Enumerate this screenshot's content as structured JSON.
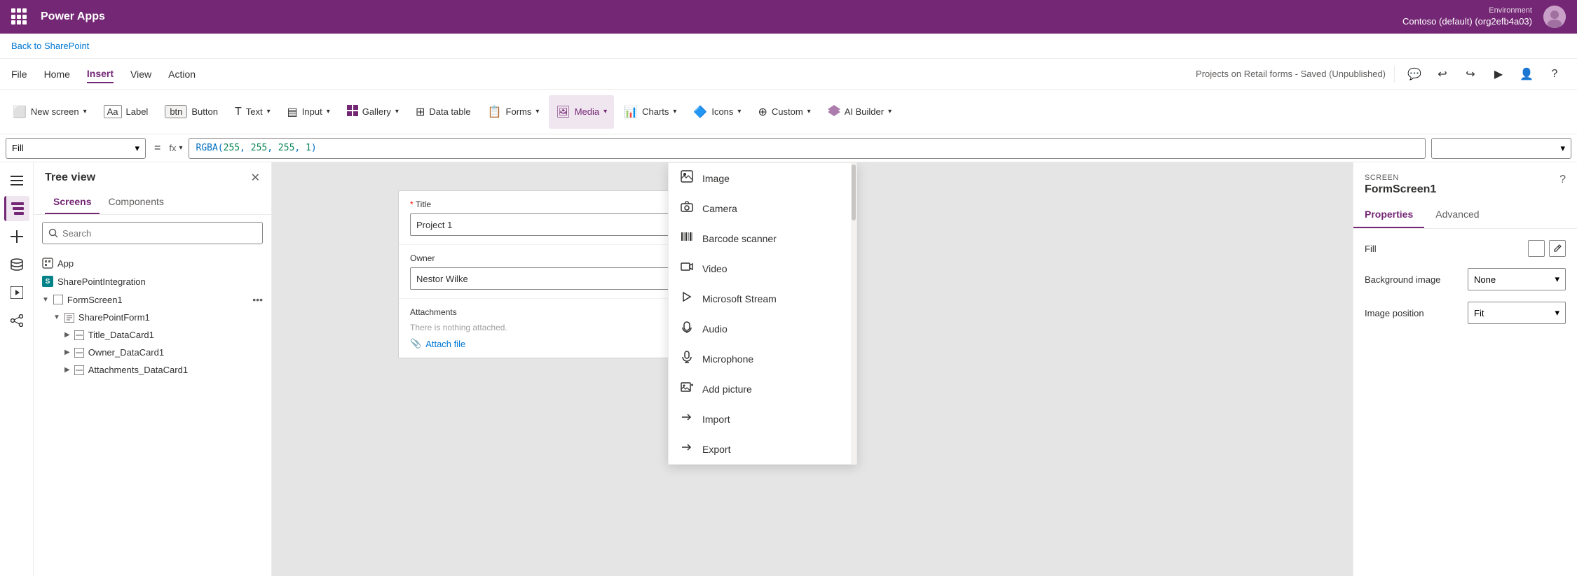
{
  "app": {
    "title": "Power Apps",
    "env_label": "Environment",
    "env_name": "Contoso (default) (org2efb4a03)"
  },
  "breadcrumb": {
    "link": "Back to SharePoint"
  },
  "menubar": {
    "items": [
      "File",
      "Home",
      "Insert",
      "View",
      "Action"
    ],
    "active": "Insert",
    "save_status": "Projects on Retail forms - Saved (Unpublished)"
  },
  "ribbon": {
    "items": [
      {
        "id": "new-screen",
        "label": "New screen",
        "icon": "⬜",
        "has_caret": true
      },
      {
        "id": "label",
        "label": "Label",
        "icon": "🏷",
        "has_caret": false
      },
      {
        "id": "button",
        "label": "Button",
        "icon": "⬛",
        "has_caret": false
      },
      {
        "id": "text",
        "label": "Text",
        "icon": "T",
        "has_caret": true
      },
      {
        "id": "input",
        "label": "Input",
        "icon": "▤",
        "has_caret": true
      },
      {
        "id": "gallery",
        "label": "Gallery",
        "icon": "▦",
        "has_caret": true
      },
      {
        "id": "data-table",
        "label": "Data table",
        "icon": "⊞",
        "has_caret": false
      },
      {
        "id": "forms",
        "label": "Forms",
        "icon": "📋",
        "has_caret": true
      },
      {
        "id": "media",
        "label": "Media",
        "icon": "🖼",
        "has_caret": true,
        "active": true
      },
      {
        "id": "charts",
        "label": "Charts",
        "icon": "📊",
        "has_caret": true
      },
      {
        "id": "icons",
        "label": "Icons",
        "icon": "🔷",
        "has_caret": true
      },
      {
        "id": "custom",
        "label": "Custom",
        "icon": "⊕",
        "has_caret": true
      },
      {
        "id": "ai-builder",
        "label": "AI Builder",
        "icon": "🤖",
        "has_caret": true
      }
    ]
  },
  "formula_bar": {
    "dropdown_label": "Fill",
    "eq_symbol": "=",
    "fx_label": "fx",
    "formula": "RGBA(255, 255, 255, 1)"
  },
  "tree_view": {
    "title": "Tree view",
    "tabs": [
      "Screens",
      "Components"
    ],
    "active_tab": "Screens",
    "search_placeholder": "Search",
    "items": [
      {
        "id": "app",
        "label": "App",
        "icon": "📱",
        "level": 0,
        "expandable": false
      },
      {
        "id": "sharepoint-integration",
        "label": "SharePointIntegration",
        "icon": "S",
        "level": 0,
        "expandable": false
      },
      {
        "id": "form-screen1",
        "label": "FormScreen1",
        "icon": "⬜",
        "level": 0,
        "expandable": true,
        "expanded": true,
        "has_ellipsis": true
      },
      {
        "id": "sharepoint-form1",
        "label": "SharePointForm1",
        "icon": "📋",
        "level": 1,
        "expandable": true,
        "expanded": true
      },
      {
        "id": "title-datacard1",
        "label": "Title_DataCard1",
        "icon": "▭",
        "level": 2,
        "expandable": true
      },
      {
        "id": "owner-datacard1",
        "label": "Owner_DataCard1",
        "icon": "▭",
        "level": 2,
        "expandable": true
      },
      {
        "id": "attachments-datacard1",
        "label": "Attachments_DataCard1",
        "icon": "▭",
        "level": 2,
        "expandable": true
      }
    ]
  },
  "canvas": {
    "form": {
      "title_field_label": "Title",
      "title_required": "*",
      "title_value": "Project 1",
      "owner_field_label": "Owner",
      "owner_value": "Nestor Wilke",
      "attachments_label": "Attachments",
      "attachments_empty": "There is nothing attached.",
      "attach_btn_label": "Attach file",
      "attach_icon": "📎"
    }
  },
  "media_dropdown": {
    "items": [
      {
        "id": "image",
        "label": "Image",
        "icon": "🖼"
      },
      {
        "id": "camera",
        "label": "Camera",
        "icon": "📷"
      },
      {
        "id": "barcode-scanner",
        "label": "Barcode scanner",
        "icon": "📊"
      },
      {
        "id": "video",
        "label": "Video",
        "icon": "📺"
      },
      {
        "id": "microsoft-stream",
        "label": "Microsoft Stream",
        "icon": "▶"
      },
      {
        "id": "audio",
        "label": "Audio",
        "icon": "🎧"
      },
      {
        "id": "microphone",
        "label": "Microphone",
        "icon": "🎤"
      },
      {
        "id": "add-picture",
        "label": "Add picture",
        "icon": "🖼"
      },
      {
        "id": "import",
        "label": "Import",
        "icon": "→"
      },
      {
        "id": "export",
        "label": "Export",
        "icon": "→"
      }
    ]
  },
  "right_panel": {
    "screen_label": "SCREEN",
    "screen_name": "FormScreen1",
    "tabs": [
      "Properties",
      "Advanced"
    ],
    "active_tab": "Properties",
    "fill_label": "Fill",
    "background_image_label": "Background image",
    "background_image_value": "None",
    "image_position_label": "Image position",
    "image_position_value": "Fit"
  }
}
